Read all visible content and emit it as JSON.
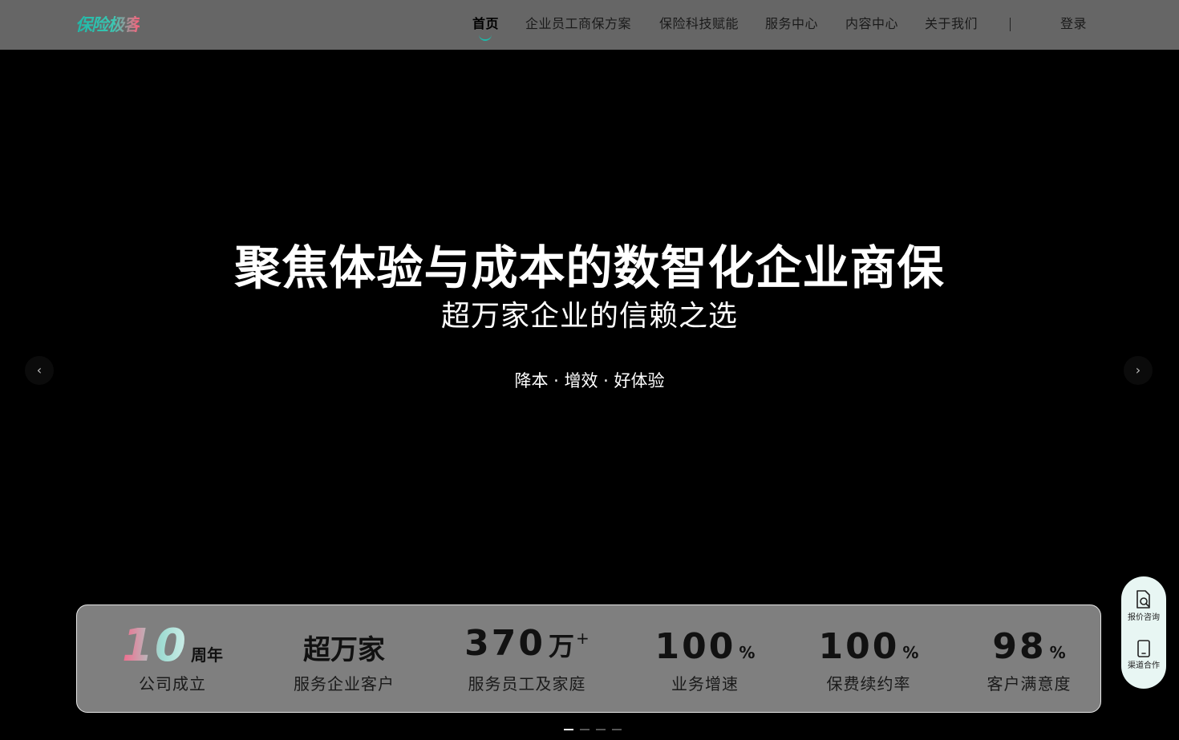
{
  "logo": {
    "text": "保险极客"
  },
  "nav": {
    "items": [
      {
        "label": "首页",
        "active": true
      },
      {
        "label": "企业员工商保方案"
      },
      {
        "label": "保险科技赋能"
      },
      {
        "label": "服务中心"
      },
      {
        "label": "内容中心"
      },
      {
        "label": "关于我们"
      }
    ],
    "divider": "|",
    "login": "登录"
  },
  "hero": {
    "title": "聚焦体验与成本的数智化企业商保",
    "subtitle": "超万家企业的信赖之选",
    "tagline": "降本 · 增效 · 好体验",
    "prev_icon": "chevron-left-icon",
    "next_icon": "chevron-right-icon"
  },
  "stats": [
    {
      "value": "10",
      "unit": "周年",
      "label": "公司成立"
    },
    {
      "value": "超万家",
      "unit": "",
      "label": "服务企业客户"
    },
    {
      "value": "370",
      "unit": "万",
      "suffix": "+",
      "label": "服务员工及家庭"
    },
    {
      "value": "100",
      "unit": "%",
      "label": "业务增速"
    },
    {
      "value": "100",
      "unit": "%",
      "label": "保费续约率"
    },
    {
      "value": "98",
      "unit": "%",
      "label": "客户满意度"
    }
  ],
  "carousel": {
    "slides": 4,
    "active_index": 0
  },
  "side_widget": {
    "quote": {
      "label": "报价咨询",
      "icon": "document-search-icon"
    },
    "channel": {
      "label": "渠道合作",
      "icon": "phone-icon"
    }
  },
  "colors": {
    "header_bg": "#666666",
    "accent": "#1fb8a8",
    "stats_bg": "#7f7f7f",
    "widget_bg": "#e8f6f3"
  }
}
